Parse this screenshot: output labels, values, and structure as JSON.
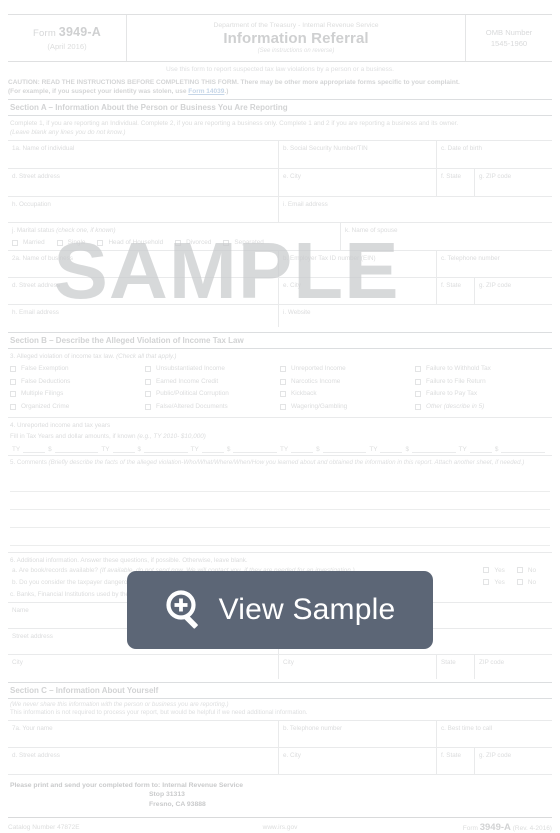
{
  "overlay": {
    "label": "View Sample",
    "icon": "magnifier-plus-icon",
    "background": "#5c6676",
    "text_color": "#ffffff"
  },
  "watermark": {
    "text": "SAMPLE",
    "color": "#c9cbcd"
  },
  "header": {
    "form_prefix": "Form",
    "form_number": "3949-A",
    "form_date": "(April 2016)",
    "agency": "Department of the Treasury - Internal Revenue Service",
    "title": "Information Referral",
    "subtitle": "(See instructions on reverse)",
    "omb_label": "OMB Number",
    "omb_value": "1545-1960",
    "use_line": "Use this form to report suspected tax law violations by a person or a business."
  },
  "caution": {
    "line1": "CAUTION: READ THE INSTRUCTIONS BEFORE COMPLETING THIS FORM. There may be other more appropriate forms specific to your complaint.",
    "line2_pre": "(For example, if you suspect your identity was stolen, use ",
    "line2_link": "Form 14039",
    "line2_post": ".)"
  },
  "section_a": {
    "heading": "Section A – Information About the Person or Business You Are Reporting",
    "note1": "Complete 1, if you are reporting an Individual. Complete 2, if you are reporting a business only. Complete 1 and 2 if you are reporting a business and its owner.",
    "note2": "(Leave blank any lines you do not know.)",
    "f1a": "1a. Name of individual",
    "f1b": "b. Social Security Number/TIN",
    "f1c": "c. Date of birth",
    "f1d": "d. Street address",
    "f1e": "e. City",
    "f1f": "f. State",
    "f1g": "g. ZIP code",
    "f1h": "h. Occupation",
    "f1i": "i. Email address",
    "f1j": "j. Marital status",
    "f1j_italic": "(check one, if known)",
    "marital_options": [
      "Married",
      "Single",
      "Head of Household",
      "Divorced",
      "Separated"
    ],
    "f1k": "k. Name of spouse",
    "f2a": "2a. Name of business",
    "f2b": "b. Employer Tax ID number (EIN)",
    "f2c": "c. Telephone number",
    "f2d": "d. Street address",
    "f2e": "e. City",
    "f2f": "f. State",
    "f2g": "g. ZIP code",
    "f2h": "h. Email address",
    "f2i": "i. Website"
  },
  "section_b": {
    "heading": "Section B – Describe the Alleged Violation of Income Tax Law",
    "item3": "3. Alleged violation of income tax law.",
    "item3_italic": "(Check all that apply.)",
    "violations_col1": [
      "False Exemption",
      "False Deductions",
      "Multiple Filings",
      "Organized Crime"
    ],
    "violations_col2": [
      "Unsubstantiated Income",
      "Earned Income Credit",
      "Public/Political Corruption",
      "False/Altered Documents"
    ],
    "violations_col3": [
      "Unreported Income",
      "Narcotics Income",
      "Kickback",
      "Wagering/Gambling"
    ],
    "violations_col4": [
      "Failure to Withhold Tax",
      "Failure to File Return",
      "Failure to Pay Tax",
      "Other (describe in 5)"
    ],
    "item4": "4. Unreported income and tax years",
    "item4_sub": "Fill in Tax Years and dollar amounts, if known",
    "item4_example": "(e.g., TY 2010- $10,000)",
    "ty_label": "TY",
    "dollar_label": "$",
    "ty_count": 6,
    "item5": "5. Comments",
    "item5_italic": "(Briefly describe the facts of the alleged violation-Who/What/Where/When/How you learned about and obtained the information in this report. Attach another sheet, if needed.)",
    "item6": "6. Additional information. Answer these questions, if possible. Otherwise, leave blank.",
    "item6a_pre": "a. Are book/records available? ",
    "item6a_italic": "(If available, do not send now. We will contact you, if they are needed for an investigation.)",
    "item6b": "b. Do you consider the taxpayer dangerous?",
    "item6c": "c. Banks, Financial Institutions used by the taxpayer",
    "yes_label": "Yes",
    "no_label": "No",
    "bank_name": "Name",
    "bank_street": "Street address",
    "bank_city": "City",
    "bank_state": "State",
    "bank_zip": "ZIP code"
  },
  "section_c": {
    "heading": "Section C – Information About Yourself",
    "note1": "(We never share this information with the person or business you are reporting.)",
    "note2": "This information is not required to process your report, but would be helpful if we need additional information.",
    "f7a": "7a. Your name",
    "f7b": "b. Telephone number",
    "f7c": "c. Best time to call",
    "f7d": "d. Street address",
    "f7e": "e. City",
    "f7f": "f. State",
    "f7g": "g. ZIP code"
  },
  "footer": {
    "send_to": "Please print and send your completed form to: Internal Revenue Service",
    "send_line2": "Stop 31313",
    "send_line3": "Fresno, CA 93888",
    "catalog": "Catalog Number 47872E",
    "website": "www.irs.gov",
    "form_prefix": "Form",
    "form_number": "3949-A",
    "form_rev": "(Rev. 4-2016)"
  }
}
